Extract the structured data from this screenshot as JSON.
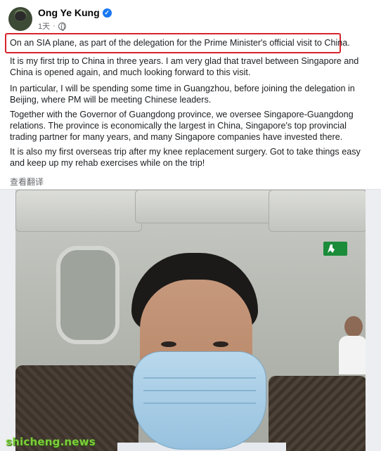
{
  "post": {
    "author": "Ong Ye Kung",
    "time": "1天",
    "verified_icon": "✓",
    "paragraphs": [
      "On an SIA plane, as part of the delegation for the Prime Minister's official visit to China.",
      "It is my first trip to China in three years. I am very glad that travel between Singapore and China is opened again, and much looking forward to this visit.",
      "In particular, I will be spending some time in Guangzhou, before joining the delegation in Beijing, where PM will be meeting Chinese leaders.",
      "Together with the Governor of Guangdong province, we oversee Singapore-Guangdong relations. The province is economically the largest in China, Singapore's top provincial trading partner for many years, and many Singapore companies have invested there.",
      "It is also my first overseas trip after my knee replacement surgery. Got to take things easy and keep up my rehab exercises while on the trip!"
    ],
    "translate_label": "查看翻译"
  },
  "watermark": "shicheng.news",
  "colors": {
    "highlight": "#d6252c",
    "verified": "#1877f2",
    "watermark": "#7ccf3a"
  },
  "icons": [
    "verified-icon",
    "globe-icon"
  ]
}
